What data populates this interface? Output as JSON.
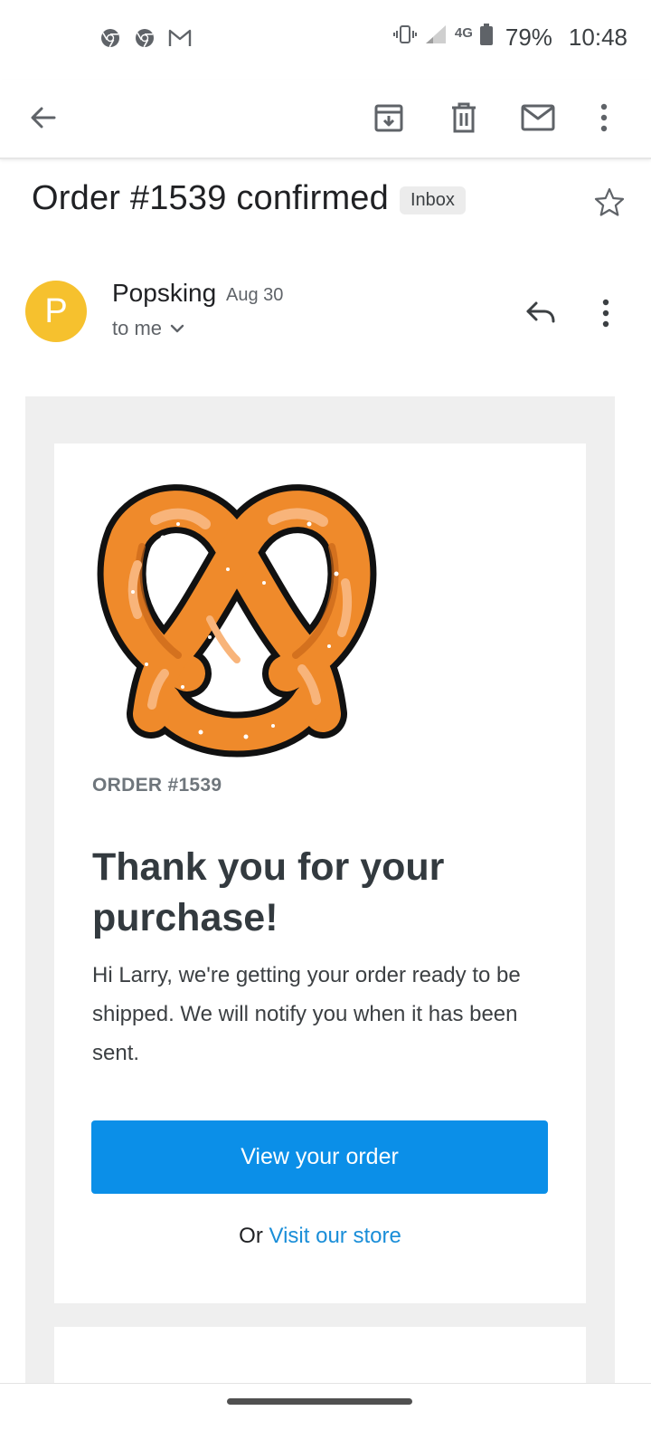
{
  "status_bar": {
    "notification_icons": [
      "chrome-icon",
      "chrome-icon",
      "gmail-icon"
    ],
    "network": "4G",
    "battery": "79%",
    "time": "10:48"
  },
  "toolbar": {
    "icons": [
      "back-arrow-icon",
      "archive-icon",
      "delete-icon",
      "mark-unread-icon",
      "more-vert-icon"
    ]
  },
  "email": {
    "subject": "Order #1539 confirmed",
    "label": "Inbox",
    "sender_initial": "P",
    "sender_name": "Popsking",
    "date": "Aug 30",
    "recipient": "to me"
  },
  "message": {
    "order_label": "ORDER #1539",
    "headline": "Thank you for your purchase!",
    "body": "Hi Larry, we're getting your order ready to be shipped. We will notify you when it has been sent.",
    "primary_button": "View your order",
    "secondary_prefix": "Or",
    "secondary_link": "Visit our store"
  },
  "colors": {
    "avatar": "#f6c12e",
    "primary_button": "#0b8fe8",
    "link": "#1a8ed8",
    "pretzel_fill": "#ef8a2b",
    "pretzel_highlight": "#f8b47a"
  }
}
